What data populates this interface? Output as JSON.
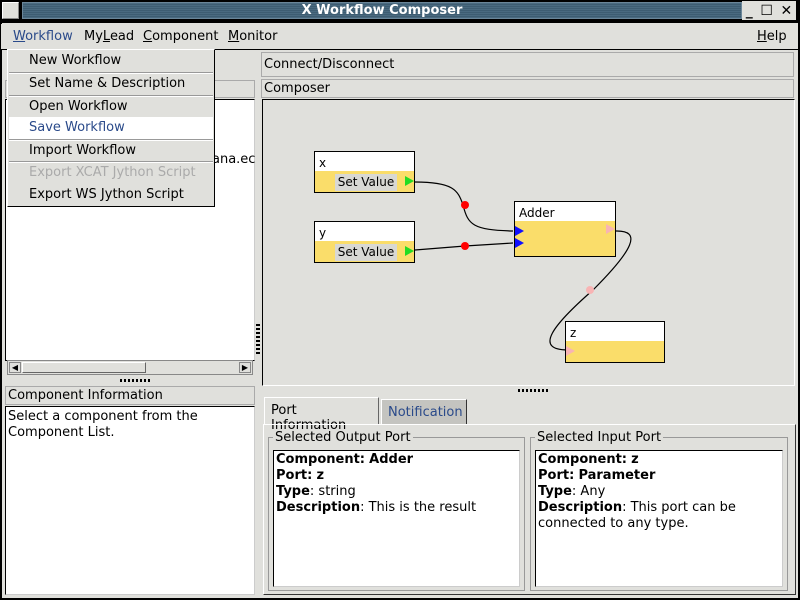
{
  "window": {
    "title": "X Workflow Composer",
    "controls": [
      "minimize",
      "maximize",
      "close"
    ]
  },
  "menubar": {
    "items": [
      {
        "label": "Workflow",
        "mnemonic": "W"
      },
      {
        "label": "MyLead",
        "mnemonic": "L"
      },
      {
        "label": "Component",
        "mnemonic": "C"
      },
      {
        "label": "Monitor",
        "mnemonic": "M"
      }
    ],
    "help": {
      "label": "Help",
      "mnemonic": "H"
    }
  },
  "workflow_menu": {
    "items": [
      {
        "label": "New Workflow",
        "enabled": true,
        "highlighted": false
      },
      {
        "label": "Set Name & Description",
        "enabled": true,
        "highlighted": false
      },
      {
        "label": "Open Workflow",
        "enabled": true,
        "highlighted": false
      },
      {
        "label": "Save Workflow",
        "enabled": true,
        "highlighted": true
      },
      {
        "label": "Import Workflow",
        "enabled": true,
        "highlighted": false
      },
      {
        "label": "Export XCAT Jython Script",
        "enabled": false,
        "highlighted": false
      },
      {
        "label": "Export WS Jython Script",
        "enabled": true,
        "highlighted": false
      }
    ]
  },
  "toolbar": {
    "connect_label": "Connect/Disconnect"
  },
  "component_list": {
    "visible_text_fragment": "ana.ec"
  },
  "component_info": {
    "header": "Component Information",
    "text": "Select a component from the Component List."
  },
  "composer": {
    "header": "Composer",
    "nodes": [
      {
        "id": "x",
        "title": "x",
        "button": "Set Value",
        "output_port_color": "#22dd22"
      },
      {
        "id": "y",
        "title": "y",
        "button": "Set Value",
        "output_port_color": "#22dd22"
      },
      {
        "id": "adder",
        "title": "Adder",
        "input_port_color": "#1010ff",
        "output_port_color": "#f8b4b4"
      },
      {
        "id": "z",
        "title": "z",
        "input_port_color": "#f8b4b4"
      }
    ],
    "connections": [
      {
        "from": "x",
        "to": "adder",
        "midpoint_color": "#ff0000"
      },
      {
        "from": "y",
        "to": "adder",
        "midpoint_color": "#ff0000"
      },
      {
        "from": "adder",
        "to": "z",
        "midpoint_color": "#f8b4b4",
        "selected": true
      }
    ],
    "node_body_color": "#fadd6a"
  },
  "tabs": [
    {
      "label": "Port Information",
      "active": true
    },
    {
      "label": "Notification",
      "active": false
    }
  ],
  "output_port": {
    "legend": "Selected Output Port",
    "component_label": "Component:",
    "component_value": "Adder",
    "port_label": "Port:",
    "port_value": "z",
    "type_label": "Type",
    "type_value": ": string",
    "desc_label": "Description",
    "desc_value": ": This is the result"
  },
  "input_port": {
    "legend": "Selected Input Port",
    "component_label": "Component:",
    "component_value": "z",
    "port_label": "Port:",
    "port_value": "Parameter",
    "type_label": "Type",
    "type_value": ": Any",
    "desc_label": "Description",
    "desc_value": ": This port can be connected to any type."
  }
}
